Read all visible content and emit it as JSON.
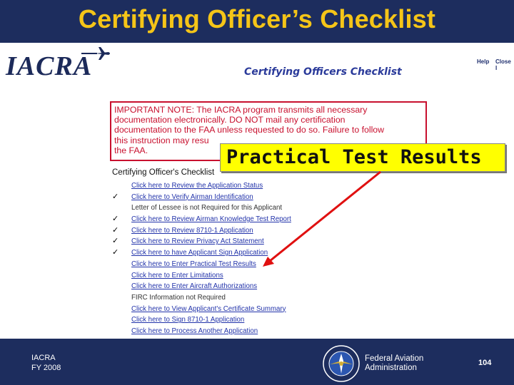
{
  "slide": {
    "title": "Certifying Officer’s Checklist"
  },
  "app": {
    "logo_text": "IACRA",
    "top_links": [
      "Help",
      "Close I"
    ],
    "page_heading": "Certifying Officers Checklist"
  },
  "notice": {
    "lines": [
      "IMPORTANT NOTE: The IACRA program transmits all necessary",
      "documentation electronically. DO NOT mail any certification",
      "documentation to the FAA unless requested to do so. Failure to follow",
      "this instruction may resu",
      "the FAA."
    ]
  },
  "checklist": {
    "label": "Certifying Officer's Checklist",
    "items": [
      {
        "text": "Click here to Review the Application Status",
        "checked": false,
        "link": true
      },
      {
        "text": "Click here to Verify Airman Identification",
        "checked": true,
        "link": true
      },
      {
        "text": "Letter of Lessee is not Required for this Applicant",
        "checked": false,
        "link": false
      },
      {
        "text": "Click here to Review Airman Knowledge Test Report",
        "checked": true,
        "link": true
      },
      {
        "text": "Click here to Review 8710-1 Application",
        "checked": true,
        "link": true
      },
      {
        "text": "Click here to Review Privacy Act Statement",
        "checked": true,
        "link": true
      },
      {
        "text": "Click here to have Applicant Sign Application",
        "checked": true,
        "link": true
      },
      {
        "text": "Click here to Enter Practical Test Results",
        "checked": false,
        "link": true
      },
      {
        "text": "Click here to Enter Limitations",
        "checked": false,
        "link": true
      },
      {
        "text": "Click here to Enter Aircraft Authorizations",
        "checked": false,
        "link": true
      },
      {
        "text": "FIRC Information not Required",
        "checked": false,
        "link": false
      },
      {
        "text": "Click here to View Applicant's Certificate Summary",
        "checked": false,
        "link": true
      },
      {
        "text": "Click here to Sign 8710-1 Application",
        "checked": false,
        "link": true
      },
      {
        "text": "Click here to Process Another Application",
        "checked": false,
        "link": true
      }
    ],
    "check_glyph": "✓"
  },
  "callout": {
    "text": "Practical Test Results"
  },
  "footer": {
    "left_line1": "IACRA",
    "left_line2": "FY 2008",
    "agency_line1": "Federal Aviation",
    "agency_line2": "Administration",
    "page_number": "104"
  },
  "colors": {
    "bar": "#1d2d5e",
    "title": "#f5c518",
    "notice": "#c8102e",
    "callout": "#ffff00",
    "arrow": "#e01010"
  }
}
